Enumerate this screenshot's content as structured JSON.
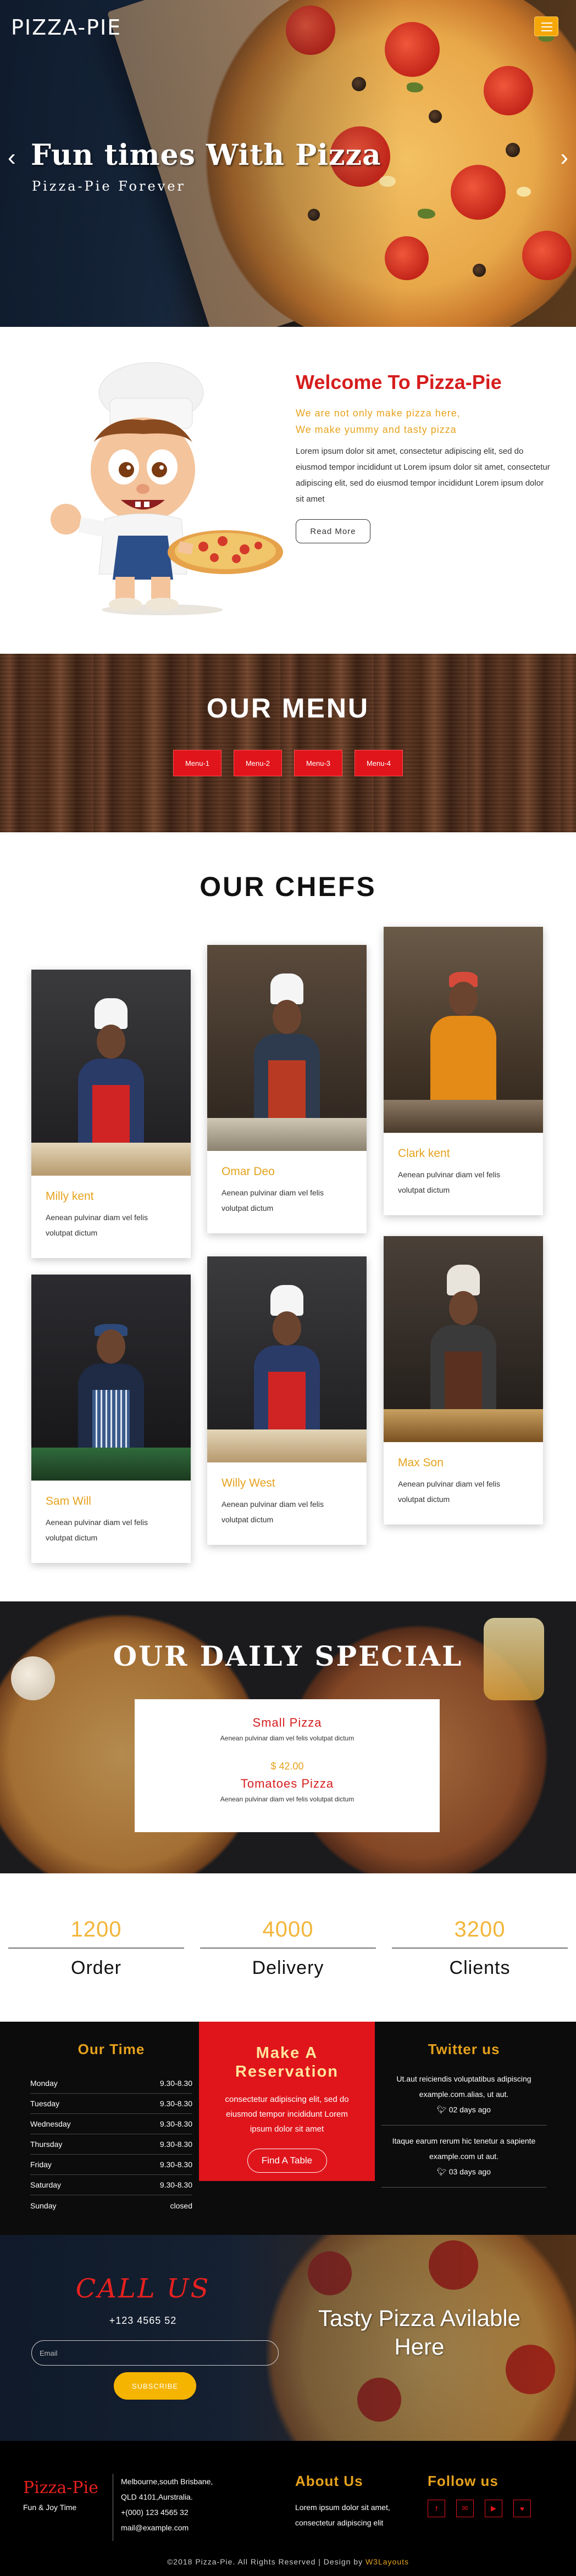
{
  "header": {
    "logo": "PIZZA-PIE",
    "menu_icon": "hamburger-menu-icon"
  },
  "hero": {
    "title": "Fun times With Pizza",
    "subtitle": "Pizza-Pie Forever",
    "prev_icon": "chevron-left-icon",
    "next_icon": "chevron-right-icon"
  },
  "welcome": {
    "title": "Welcome To Pizza-Pie",
    "line1": "We are not only make pizza here,",
    "line2": "We make yummy and tasty pizza",
    "para": "Lorem ipsum dolor sit amet, consectetur adipiscing elit, sed do eiusmod tempor incididunt ut Lorem ipsum dolor sit amet, consectetur adipiscing elit, sed do eiusmod tempor incididunt Lorem ipsum dolor sit amet",
    "button": "Read More"
  },
  "menu": {
    "title": "OUR MENU",
    "tabs": [
      "Menu-1",
      "Menu-2",
      "Menu-3",
      "Menu-4"
    ]
  },
  "chefs": {
    "title": "OUR CHEFS",
    "items": [
      {
        "name": "Milly kent",
        "desc": "Aenean pulvinar diam vel felis volutpat dictum"
      },
      {
        "name": "Omar Deo",
        "desc": "Aenean pulvinar diam vel felis volutpat dictum"
      },
      {
        "name": "Clark kent",
        "desc": "Aenean pulvinar diam vel felis volutpat dictum"
      },
      {
        "name": "Sam Will",
        "desc": "Aenean pulvinar diam vel felis volutpat dictum"
      },
      {
        "name": "Willy West",
        "desc": "Aenean pulvinar diam vel felis volutpat dictum"
      },
      {
        "name": "Max Son",
        "desc": "Aenean pulvinar diam vel felis volutpat dictum"
      }
    ]
  },
  "special": {
    "title": "OUR DAILY SPECIAL",
    "item1_name": "Small Pizza",
    "item1_desc": "Aenean pulvinar diam vel felis volutpat dictum",
    "price": "$ 42.00",
    "item2_name": "Tomatoes Pizza",
    "item2_desc": "Aenean pulvinar diam vel felis volutpat dictum"
  },
  "counters": [
    {
      "value": "1200",
      "label": "Order"
    },
    {
      "value": "4000",
      "label": "Delivery"
    },
    {
      "value": "3200",
      "label": "Clients"
    }
  ],
  "hours": {
    "title": "Our Time",
    "rows": [
      {
        "day": "Monday",
        "time": "9.30-8.30"
      },
      {
        "day": "Tuesday",
        "time": "9.30-8.30"
      },
      {
        "day": "Wednesday",
        "time": "9.30-8.30"
      },
      {
        "day": "Thursday",
        "time": "9.30-8.30"
      },
      {
        "day": "Friday",
        "time": "9.30-8.30"
      },
      {
        "day": "Saturday",
        "time": "9.30-8.30"
      },
      {
        "day": "Sunday",
        "time": "closed"
      }
    ]
  },
  "reservation": {
    "title1": "Make A",
    "title2": "Reservation",
    "text": "consectetur adipiscing elit, sed do eiusmod tempor incididunt Lorem ipsum dolor sit amet",
    "button": "Find A Table"
  },
  "twitter": {
    "title": "Twitter us",
    "tweets": [
      {
        "text": "Ut.aut reiciendis voluptatibus adipiscing example.com.alias, ut aut.",
        "time": "02 days ago"
      },
      {
        "text": "Itaque earum rerum hic tenetur a sapiente example.com ut aut.",
        "time": "03 days ago"
      }
    ]
  },
  "callus": {
    "title": "CALL US",
    "phone": "+123 4565 52",
    "email_placeholder": "Email",
    "button": "SUBSCRIBE",
    "tagline": "Tasty Pizza Avilable Here"
  },
  "footer": {
    "brand": "Pizza-Pie",
    "tagline": "Fun & Joy Time",
    "addr1": "Melbourne,south Brisbane,",
    "addr2": "QLD 4101,Aurstralia.",
    "phone": "+(000) 123 4565 32",
    "email": "mail@example.com",
    "about_title": "About Us",
    "about_text": "Lorem ipsum dolor sit amet, consectetur adipiscing elit",
    "follow_title": "Follow us",
    "socials": [
      "facebook-icon",
      "email-icon",
      "youtube-icon",
      "heart-icon"
    ],
    "copyright": "©2018 Pizza-Pie. All Rights Reserved | Design by",
    "copyright_brand": "W3Layouts"
  },
  "colors": {
    "accent_red": "#e0151b",
    "accent_yellow": "#e6a21d",
    "dark": "#0c0c0c"
  }
}
